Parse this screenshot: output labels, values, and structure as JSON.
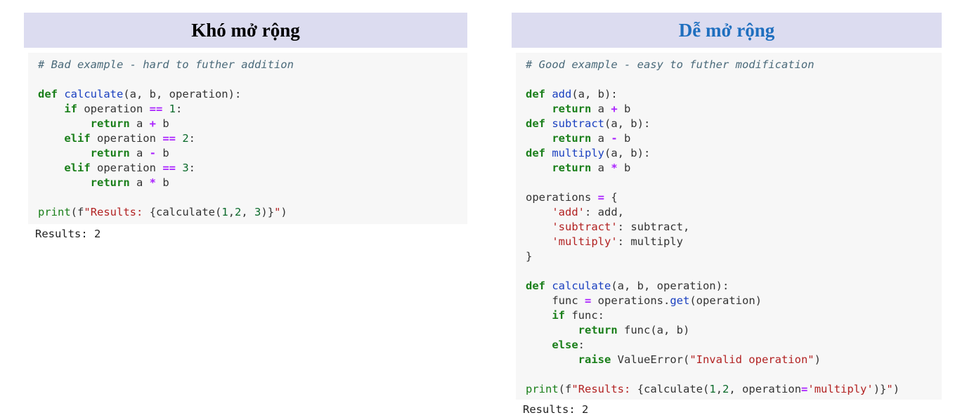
{
  "left": {
    "title": "Khó mở rộng",
    "result": "Results: 2",
    "lines": [
      [
        [
          "cm",
          "# Bad example - hard to futher addition"
        ]
      ],
      [],
      [
        [
          "kw",
          "def "
        ],
        [
          "fn",
          "calculate"
        ],
        [
          "t",
          "(a, b, operation):"
        ]
      ],
      [
        [
          "t",
          "    "
        ],
        [
          "kw",
          "if"
        ],
        [
          "t",
          " operation "
        ],
        [
          "op",
          "=="
        ],
        [
          "t",
          " "
        ],
        [
          "num",
          "1"
        ],
        [
          "t",
          ":"
        ]
      ],
      [
        [
          "t",
          "        "
        ],
        [
          "kw",
          "return"
        ],
        [
          "t",
          " a "
        ],
        [
          "op",
          "+"
        ],
        [
          "t",
          " b"
        ]
      ],
      [
        [
          "t",
          "    "
        ],
        [
          "kw",
          "elif"
        ],
        [
          "t",
          " operation "
        ],
        [
          "op",
          "=="
        ],
        [
          "t",
          " "
        ],
        [
          "num",
          "2"
        ],
        [
          "t",
          ":"
        ]
      ],
      [
        [
          "t",
          "        "
        ],
        [
          "kw",
          "return"
        ],
        [
          "t",
          " a "
        ],
        [
          "op",
          "-"
        ],
        [
          "t",
          " b"
        ]
      ],
      [
        [
          "t",
          "    "
        ],
        [
          "kw",
          "elif"
        ],
        [
          "t",
          " operation "
        ],
        [
          "op",
          "=="
        ],
        [
          "t",
          " "
        ],
        [
          "num",
          "3"
        ],
        [
          "t",
          ":"
        ]
      ],
      [
        [
          "t",
          "        "
        ],
        [
          "kw",
          "return"
        ],
        [
          "t",
          " a "
        ],
        [
          "op",
          "*"
        ],
        [
          "t",
          " b"
        ]
      ],
      [],
      [
        [
          "bi",
          "print"
        ],
        [
          "t",
          "("
        ],
        [
          "t",
          "f"
        ],
        [
          "str",
          "\"Results: "
        ],
        [
          "t",
          "{calculate("
        ],
        [
          "num",
          "1"
        ],
        [
          "t",
          ","
        ],
        [
          "num",
          "2"
        ],
        [
          "t",
          ", "
        ],
        [
          "num",
          "3"
        ],
        [
          "t",
          ")}"
        ],
        [
          "str",
          "\""
        ],
        [
          "t",
          ")"
        ]
      ]
    ]
  },
  "right": {
    "title": "Dễ mở rộng",
    "result": "Results: 2",
    "lines": [
      [
        [
          "cm",
          "# Good example - easy to futher modification"
        ]
      ],
      [],
      [
        [
          "kw",
          "def "
        ],
        [
          "fn",
          "add"
        ],
        [
          "t",
          "(a, b):"
        ]
      ],
      [
        [
          "t",
          "    "
        ],
        [
          "kw",
          "return"
        ],
        [
          "t",
          " a "
        ],
        [
          "op",
          "+"
        ],
        [
          "t",
          " b"
        ]
      ],
      [
        [
          "kw",
          "def "
        ],
        [
          "fn",
          "subtract"
        ],
        [
          "t",
          "(a, b):"
        ]
      ],
      [
        [
          "t",
          "    "
        ],
        [
          "kw",
          "return"
        ],
        [
          "t",
          " a "
        ],
        [
          "op",
          "-"
        ],
        [
          "t",
          " b"
        ]
      ],
      [
        [
          "kw",
          "def "
        ],
        [
          "fn",
          "multiply"
        ],
        [
          "t",
          "(a, b):"
        ]
      ],
      [
        [
          "t",
          "    "
        ],
        [
          "kw",
          "return"
        ],
        [
          "t",
          " a "
        ],
        [
          "op",
          "*"
        ],
        [
          "t",
          " b"
        ]
      ],
      [],
      [
        [
          "t",
          "operations "
        ],
        [
          "op",
          "="
        ],
        [
          "t",
          " {"
        ]
      ],
      [
        [
          "t",
          "    "
        ],
        [
          "str",
          "'add'"
        ],
        [
          "t",
          ": add,"
        ]
      ],
      [
        [
          "t",
          "    "
        ],
        [
          "str",
          "'subtract'"
        ],
        [
          "t",
          ": subtract,"
        ]
      ],
      [
        [
          "t",
          "    "
        ],
        [
          "str",
          "'multiply'"
        ],
        [
          "t",
          ": multiply"
        ]
      ],
      [
        [
          "t",
          "}"
        ]
      ],
      [],
      [
        [
          "kw",
          "def "
        ],
        [
          "fn",
          "calculate"
        ],
        [
          "t",
          "(a, b, operation):"
        ]
      ],
      [
        [
          "t",
          "    func "
        ],
        [
          "op",
          "="
        ],
        [
          "t",
          " operations."
        ],
        [
          "fn",
          "get"
        ],
        [
          "t",
          "(operation)"
        ]
      ],
      [
        [
          "t",
          "    "
        ],
        [
          "kw",
          "if"
        ],
        [
          "t",
          " func:"
        ]
      ],
      [
        [
          "t",
          "        "
        ],
        [
          "kw",
          "return"
        ],
        [
          "t",
          " func(a, b)"
        ]
      ],
      [
        [
          "t",
          "    "
        ],
        [
          "kw",
          "else"
        ],
        [
          "t",
          ":"
        ]
      ],
      [
        [
          "t",
          "        "
        ],
        [
          "kw",
          "raise"
        ],
        [
          "t",
          " ValueError("
        ],
        [
          "str",
          "\"Invalid operation\""
        ],
        [
          "t",
          ")"
        ]
      ],
      [],
      [
        [
          "bi",
          "print"
        ],
        [
          "t",
          "("
        ],
        [
          "t",
          "f"
        ],
        [
          "str",
          "\"Results: "
        ],
        [
          "t",
          "{calculate("
        ],
        [
          "num",
          "1"
        ],
        [
          "t",
          ","
        ],
        [
          "num",
          "2"
        ],
        [
          "t",
          ", operation"
        ],
        [
          "op",
          "="
        ],
        [
          "str",
          "'multiply'"
        ],
        [
          "t",
          ")}"
        ],
        [
          "str",
          "\""
        ],
        [
          "t",
          ")"
        ]
      ]
    ]
  }
}
